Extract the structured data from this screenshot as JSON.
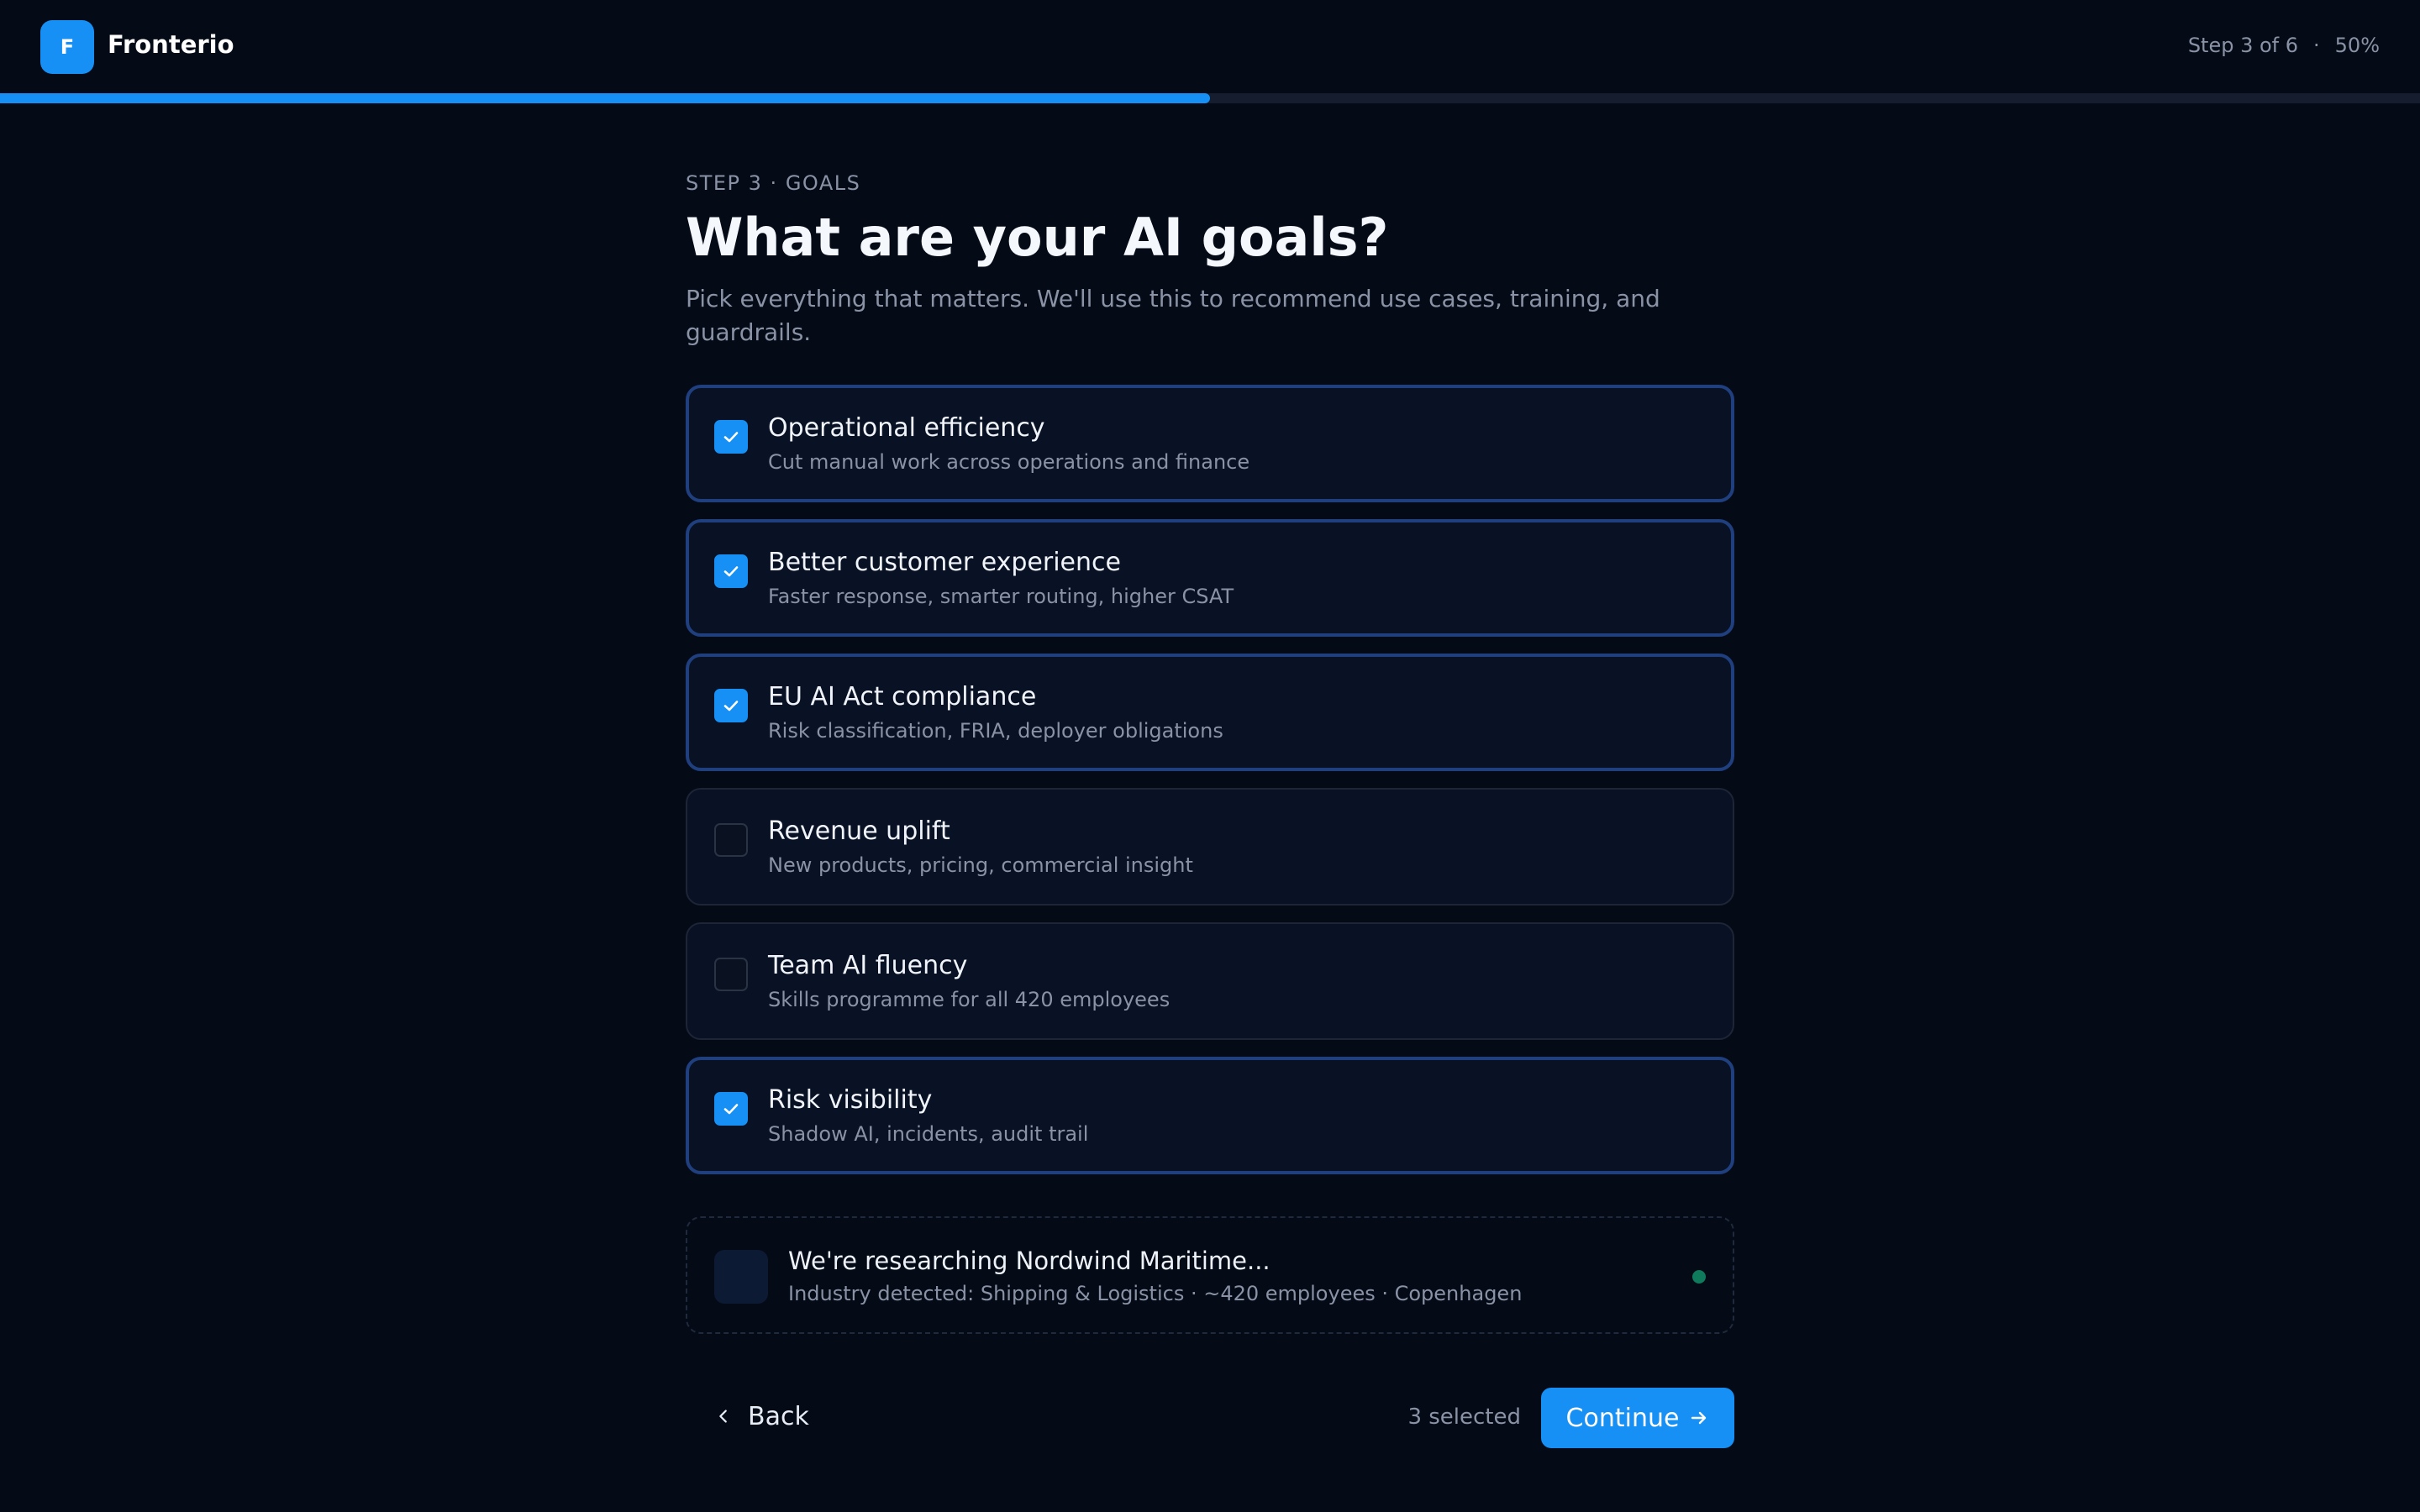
{
  "header": {
    "logo_letter": "F",
    "brand": "Fronterio",
    "step_text": "Step 3 of 6",
    "separator": "·",
    "percent_text": "50%",
    "progress": 0.5,
    "accent_color": "#1690f5"
  },
  "main": {
    "eyebrow": "STEP 3 · GOALS",
    "title": "What are your AI goals?",
    "subtitle": "Pick everything that matters. We'll use this to recommend use cases, training, and guardrails."
  },
  "options": [
    {
      "title": "Operational efficiency",
      "description": "Cut manual work across operations and finance",
      "selected": true
    },
    {
      "title": "Better customer experience",
      "description": "Faster response, smarter routing, higher CSAT",
      "selected": true
    },
    {
      "title": "EU AI Act compliance",
      "description": "Risk classification, FRIA, deployer obligations",
      "selected": true
    },
    {
      "title": "Revenue uplift",
      "description": "New products, pricing, commercial insight",
      "selected": false
    },
    {
      "title": "Team AI fluency",
      "description": "Skills programme for all 420 employees",
      "selected": false
    },
    {
      "title": "Risk visibility",
      "description": "Shadow AI, incidents, audit trail",
      "selected": true
    }
  ],
  "research": {
    "title": "We're researching Nordwind Maritime...",
    "meta": "Industry detected: Shipping & Logistics · ~420 employees · Copenhagen",
    "status_color": "#0f7a5c"
  },
  "footer": {
    "back_label": "Back",
    "selected_count": "3 selected",
    "continue_label": "Continue"
  }
}
